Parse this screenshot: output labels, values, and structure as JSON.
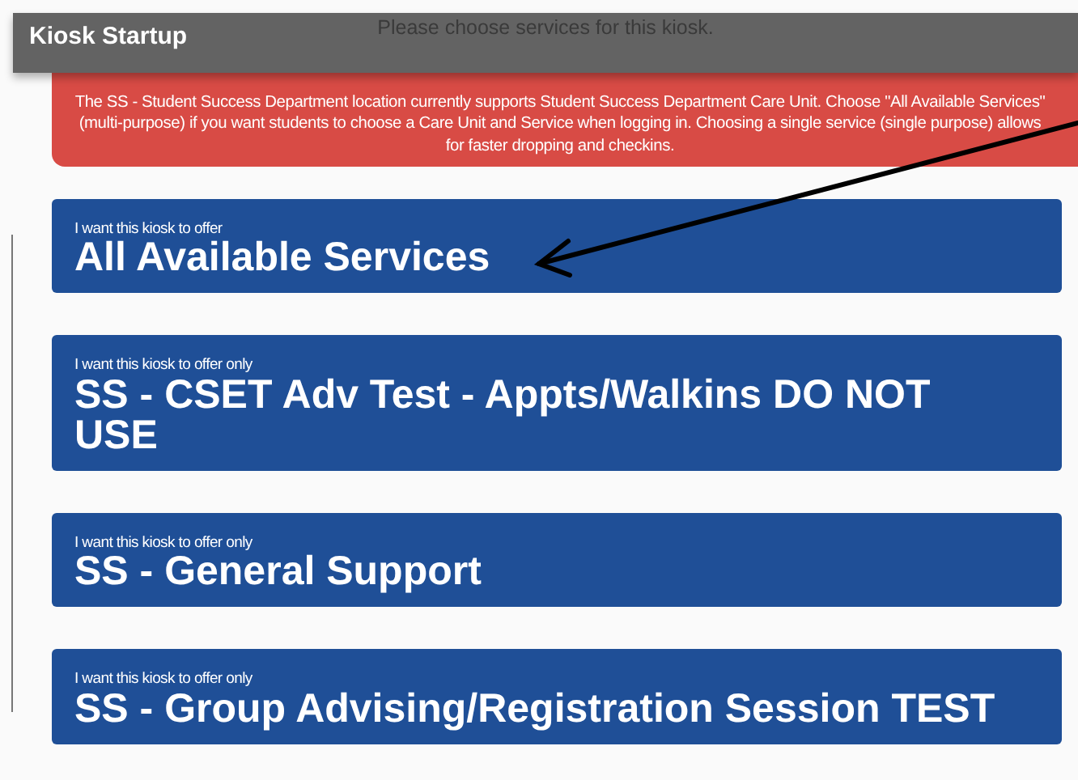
{
  "header": {
    "title": "Kiosk Startup",
    "subtitle": "Please choose services for this kiosk."
  },
  "alert": {
    "text": "The SS - Student Success Department location currently supports Student Success Department Care Unit. Choose \"All Available Services\" (multi-purpose) if you want students to choose a Care Unit and Service when logging in. Choosing a single service (single purpose) allows for faster dropping and checkins."
  },
  "services": [
    {
      "caption": "I want this kiosk to offer",
      "name": "All Available Services"
    },
    {
      "caption": "I want this kiosk to offer only",
      "name": "SS - CSET Adv Test - Appts/Walkins DO NOT USE"
    },
    {
      "caption": "I want this kiosk to offer only",
      "name": "SS - General Support"
    },
    {
      "caption": "I want this kiosk to offer only",
      "name": "SS - Group Advising/Registration Session TEST"
    }
  ]
}
